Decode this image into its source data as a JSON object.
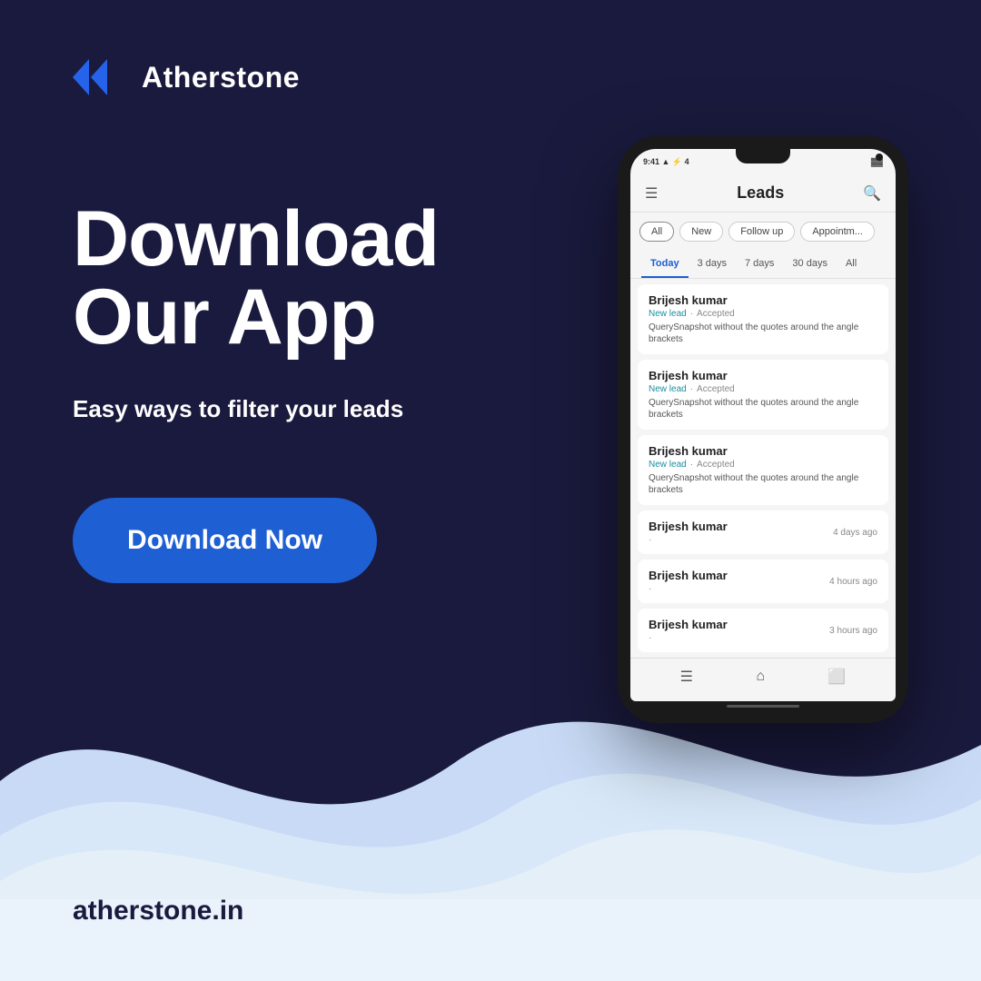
{
  "brand": {
    "name": "Atherstone",
    "website": "atherstone.in"
  },
  "hero": {
    "headline_line1": "Download",
    "headline_line2": "Our App",
    "subtitle": "Easy ways to filter your leads",
    "cta_label": "Download Now"
  },
  "app": {
    "title": "Leads",
    "filter_tabs": [
      "All",
      "New",
      "Follow up",
      "Appointm..."
    ],
    "date_tabs": [
      "Today",
      "3 days",
      "7 days",
      "30 days",
      "All"
    ],
    "leads": [
      {
        "name": "Brijesh kumar",
        "status": "New lead",
        "status_extra": "Accepted",
        "desc": "QuerySnapshot without the quotes around the angle brackets"
      },
      {
        "name": "Brijesh kumar",
        "status": "New lead",
        "status_extra": "Accepted",
        "desc": "QuerySnapshot without the quotes around the angle brackets"
      },
      {
        "name": "Brijesh kumar",
        "status": "New lead",
        "status_extra": "Accepted",
        "desc": "QuerySnapshot without the quotes around the angle brackets"
      },
      {
        "name": "Brijesh kumar",
        "time": "4 days ago"
      },
      {
        "name": "Brijesh kumar",
        "time": "4 hours ago"
      },
      {
        "name": "Brijesh kumar",
        "time": "3 hours ago"
      }
    ]
  },
  "colors": {
    "dark_bg": "#1a1a3e",
    "btn_blue": "#1e5fd4",
    "logo_blue": "#2563eb",
    "wave_light": "#d4e4f7",
    "teal_status": "#1a8fa0"
  }
}
